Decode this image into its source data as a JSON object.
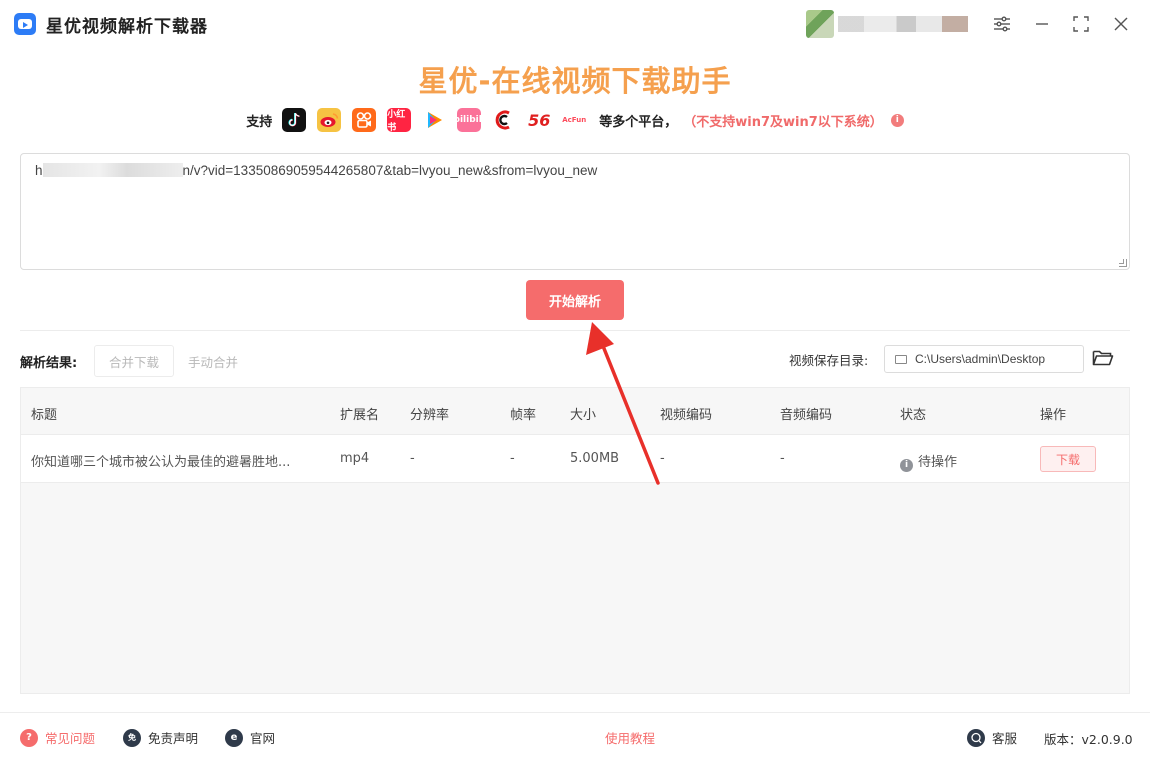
{
  "app": {
    "title": "星优视频解析下载器",
    "hero_title": "星优-在线视频下载助手"
  },
  "platforms": {
    "support_label": "支持",
    "more_text": "等多个平台，",
    "warning": "（不支持win7及win7以下系统）",
    "items": [
      "douyin-icon",
      "weibo-icon",
      "kuaishou-icon",
      "xiaohongshu-icon",
      "tencent-video-icon",
      "bilibili-icon",
      "cctv-icon",
      "56-icon",
      "acfun-icon"
    ],
    "xhs_text": "小红书",
    "bili_text": "bilibili",
    "num56": "56",
    "acfun_text": "AcFun"
  },
  "url_input": {
    "prefix": "h",
    "value_suffix": "n/v?vid=13350869059544265807&tab=lvyou_new&sfrom=lvyou_new"
  },
  "buttons": {
    "parse": "开始解析",
    "merge_download": "合并下载",
    "manual_merge": "手动合并",
    "download": "下载"
  },
  "results": {
    "label": "解析结果:",
    "save_dir_label": "视频保存目录:",
    "save_dir": "C:\\Users\\admin\\Desktop"
  },
  "table": {
    "headers": [
      "标题",
      "扩展名",
      "分辨率",
      "帧率",
      "大小",
      "视频编码",
      "音频编码",
      "状态",
      "操作"
    ],
    "rows": [
      {
        "title": "你知道哪三个城市被公认为最佳的避暑胜地...",
        "ext": "mp4",
        "resolution": "-",
        "fps": "-",
        "size": "5.00MB",
        "video_codec": "-",
        "audio_codec": "-",
        "status": "待操作"
      }
    ]
  },
  "footer": {
    "faq": "常见问题",
    "disclaimer": "免责声明",
    "website": "官网",
    "tutorial": "使用教程",
    "service": "客服",
    "version": "版本：v2.0.9.0"
  },
  "colors": {
    "accent": "#f56c6c",
    "hero": "#f5a04e",
    "arrow": "#e8302a"
  }
}
